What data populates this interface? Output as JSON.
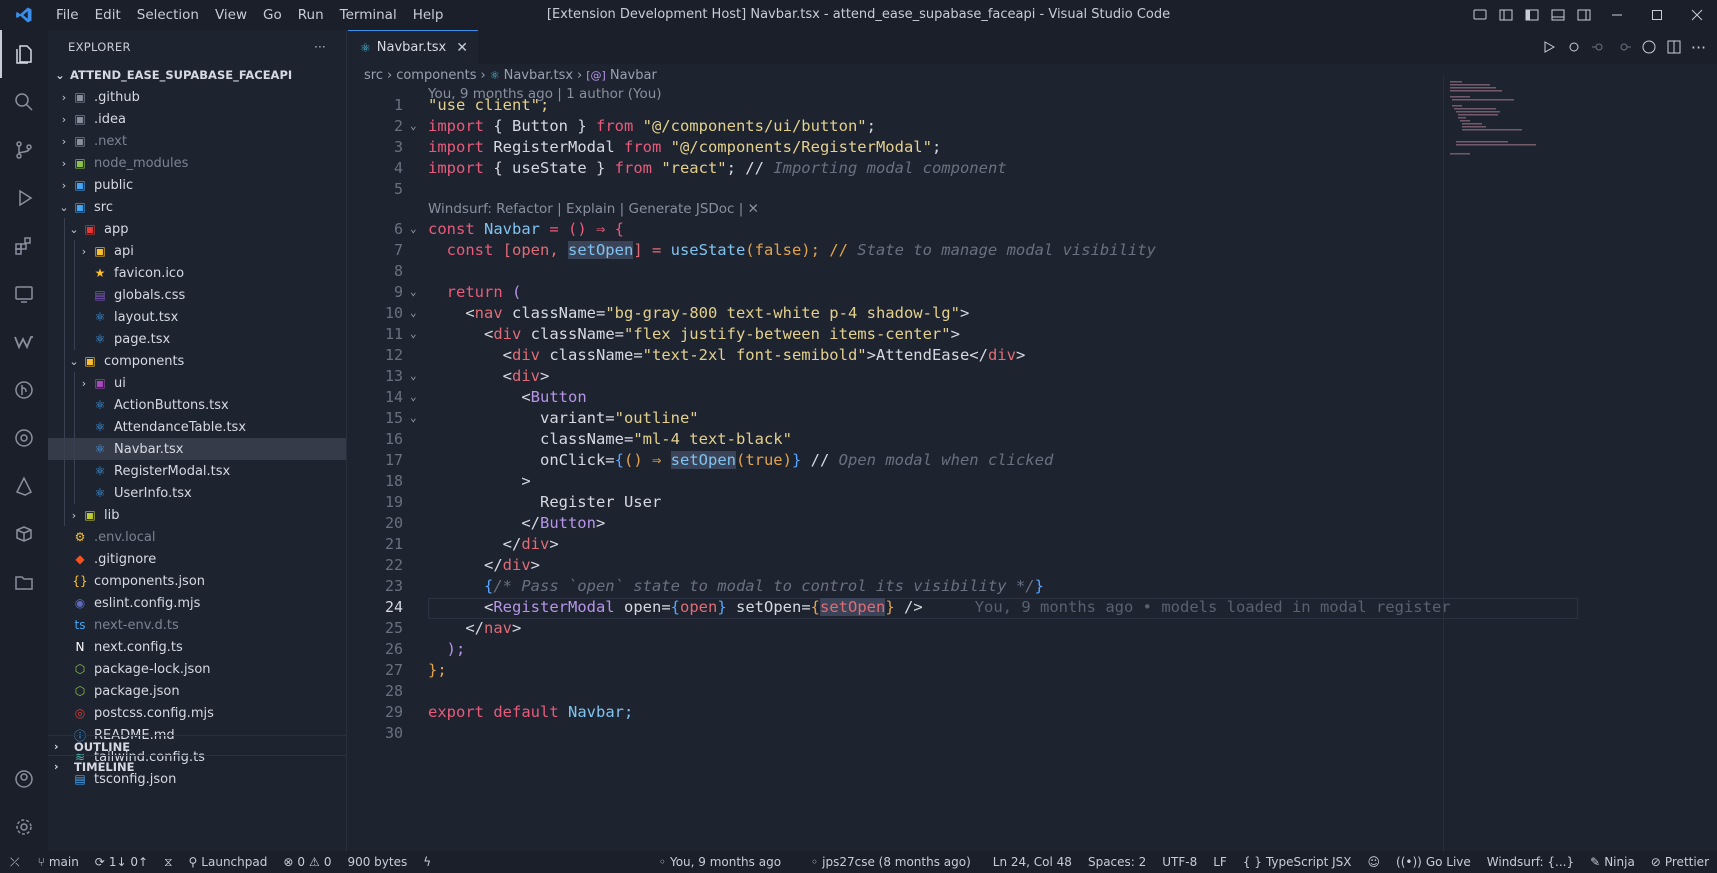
{
  "titlebar": {
    "menus": [
      "File",
      "Edit",
      "Selection",
      "View",
      "Go",
      "Run",
      "Terminal",
      "Help"
    ],
    "window_title": "[Extension Development Host] Navbar.tsx - attend_ease_supabase_faceapi - Visual Studio Code"
  },
  "sidebar": {
    "header": "EXPLORER",
    "more": "···",
    "root": "ATTEND_EASE_SUPABASE_FACEAPI",
    "items": [
      {
        "label": ".github",
        "icon": "folder-github-icon"
      },
      {
        "label": ".idea",
        "icon": "folder-idea-icon"
      },
      {
        "label": ".next",
        "icon": "folder-next-icon"
      },
      {
        "label": "node_modules",
        "icon": "folder-node-icon"
      },
      {
        "label": "public",
        "icon": "folder-public-icon"
      },
      {
        "label": "src",
        "icon": "folder-src-icon"
      },
      {
        "label": "app",
        "icon": "folder-app-icon"
      },
      {
        "label": "api",
        "icon": "folder-api-icon"
      },
      {
        "label": "favicon.ico",
        "icon": "favicon-icon"
      },
      {
        "label": "globals.css",
        "icon": "css-icon"
      },
      {
        "label": "layout.tsx",
        "icon": "react-icon"
      },
      {
        "label": "page.tsx",
        "icon": "react-icon"
      },
      {
        "label": "components",
        "icon": "folder-components-icon"
      },
      {
        "label": "ui",
        "icon": "folder-ui-icon"
      },
      {
        "label": "ActionButtons.tsx",
        "icon": "react-icon"
      },
      {
        "label": "AttendanceTable.tsx",
        "icon": "react-icon"
      },
      {
        "label": "Navbar.tsx",
        "icon": "react-icon"
      },
      {
        "label": "RegisterModal.tsx",
        "icon": "react-icon"
      },
      {
        "label": "UserInfo.tsx",
        "icon": "react-icon"
      },
      {
        "label": "lib",
        "icon": "folder-lib-icon"
      },
      {
        "label": ".env.local",
        "icon": "env-icon"
      },
      {
        "label": ".gitignore",
        "icon": "git-icon"
      },
      {
        "label": "components.json",
        "icon": "json-icon"
      },
      {
        "label": "eslint.config.mjs",
        "icon": "eslint-icon"
      },
      {
        "label": "next-env.d.ts",
        "icon": "ts-icon"
      },
      {
        "label": "next.config.ts",
        "icon": "next-icon"
      },
      {
        "label": "package-lock.json",
        "icon": "node-icon"
      },
      {
        "label": "package.json",
        "icon": "node-icon"
      },
      {
        "label": "postcss.config.mjs",
        "icon": "postcss-icon"
      },
      {
        "label": "README.md",
        "icon": "info-icon"
      },
      {
        "label": "tailwind.config.ts",
        "icon": "tailwind-icon"
      },
      {
        "label": "tsconfig.json",
        "icon": "tsconfig-icon"
      }
    ],
    "outline": "OUTLINE",
    "timeline": "TIMELINE"
  },
  "editor": {
    "tab": "Navbar.tsx",
    "breadcrumb": [
      "src",
      "components",
      "Navbar.tsx",
      "Navbar"
    ],
    "blame_header": "You, 9 months ago | 1 author (You)",
    "codelens": "Windsurf: Refactor | Explain | Generate JSDoc | ✕",
    "inline_blame": "You, 9 months ago • models loaded in modal register",
    "line_numbers": [
      "1",
      "2",
      "3",
      "4",
      "5",
      "6",
      "7",
      "8",
      "9",
      "10",
      "11",
      "12",
      "13",
      "14",
      "15",
      "16",
      "17",
      "18",
      "19",
      "20",
      "21",
      "22",
      "23",
      "24",
      "25",
      "26",
      "27",
      "28",
      "29",
      "30"
    ],
    "code": {
      "l1": "\"use client\";",
      "l2a": "import",
      "l2b": " { Button } ",
      "l2c": "from",
      "l2d": " \"@/components/ui/button\"",
      "l2e": ";",
      "l3a": "import",
      "l3b": " RegisterModal ",
      "l3c": "from",
      "l3d": " \"@/components/RegisterModal\"",
      "l3e": ";",
      "l4a": "import",
      "l4b": " { useState } ",
      "l4c": "from",
      "l4d": " \"react\"",
      "l4e": "; // ",
      "l4f": "Importing modal component",
      "l6a": "const",
      "l6b": " Navbar",
      "l6c": " = () ⇒ {",
      "l7a": "  const",
      "l7b": " [open, ",
      "l7c": "setOpen",
      "l7d": "] = ",
      "l7e": "useState",
      "l7f": "(false); // ",
      "l7g": "State to manage modal visibility",
      "l9a": "  return",
      "l9b": " (",
      "l10a": "    <",
      "l10b": "nav",
      "l10c": " className=",
      "l10d": "\"bg-gray-800 text-white p-4 shadow-lg\"",
      "l10e": ">",
      "l11a": "      <",
      "l11b": "div",
      "l11c": " className=",
      "l11d": "\"flex justify-between items-center\"",
      "l11e": ">",
      "l12a": "        <",
      "l12b": "div",
      "l12c": " className=",
      "l12d": "\"text-2xl font-semibold\"",
      "l12e": ">AttendEase</",
      "l12f": "div",
      "l12g": ">",
      "l13a": "        <",
      "l13b": "div",
      "l13c": ">",
      "l14a": "          <",
      "l14b": "Button",
      "l15a": "            variant=",
      "l15b": "\"outline\"",
      "l16a": "            className=",
      "l16b": "\"ml-4 text-black\"",
      "l17a": "            onClick=",
      "l17b": "{",
      "l17c": "() ⇒ ",
      "l17d": "setOpen",
      "l17e": "(true)",
      "l17f": "}",
      "l17g": " // ",
      "l17h": "Open modal when clicked",
      "l18": "          >",
      "l19": "            Register User",
      "l20a": "          </",
      "l20b": "Button",
      "l20c": ">",
      "l21a": "        </",
      "l21b": "div",
      "l21c": ">",
      "l22a": "      </",
      "l22b": "div",
      "l22c": ">",
      "l23a": "      {",
      "l23b": "/* Pass `open` state to modal to control its visibility */",
      "l23c": "}",
      "l24a": "      <",
      "l24b": "RegisterModal",
      "l24c": " open=",
      "l24d": "{",
      "l24e": "open",
      "l24f": "}",
      "l24g": " setOpen=",
      "l24h": "{",
      "l24i": "setOpen",
      "l24j": "}",
      "l24k": " />",
      "l25a": "    </",
      "l25b": "nav",
      "l25c": ">",
      "l26": "  );",
      "l27": "};",
      "l29a": "export",
      "l29b": " default",
      "l29c": " Navbar;"
    }
  },
  "statusbar": {
    "branch": "main",
    "sync": "1↓ 0↑",
    "launchpad": "Launchpad",
    "problems": "0",
    "warnings": "0",
    "size": "900 bytes",
    "blame": "You, 9 months ago",
    "author": "jps27cse (8 months ago)",
    "cursor": "Ln 24, Col 48",
    "spaces": "Spaces: 2",
    "encoding": "UTF-8",
    "eol": "LF",
    "language": "TypeScript JSX",
    "golive": "Go Live",
    "windsurf": "Windsurf: {...}",
    "ninja": "Ninja",
    "prettier": "Prettier"
  }
}
